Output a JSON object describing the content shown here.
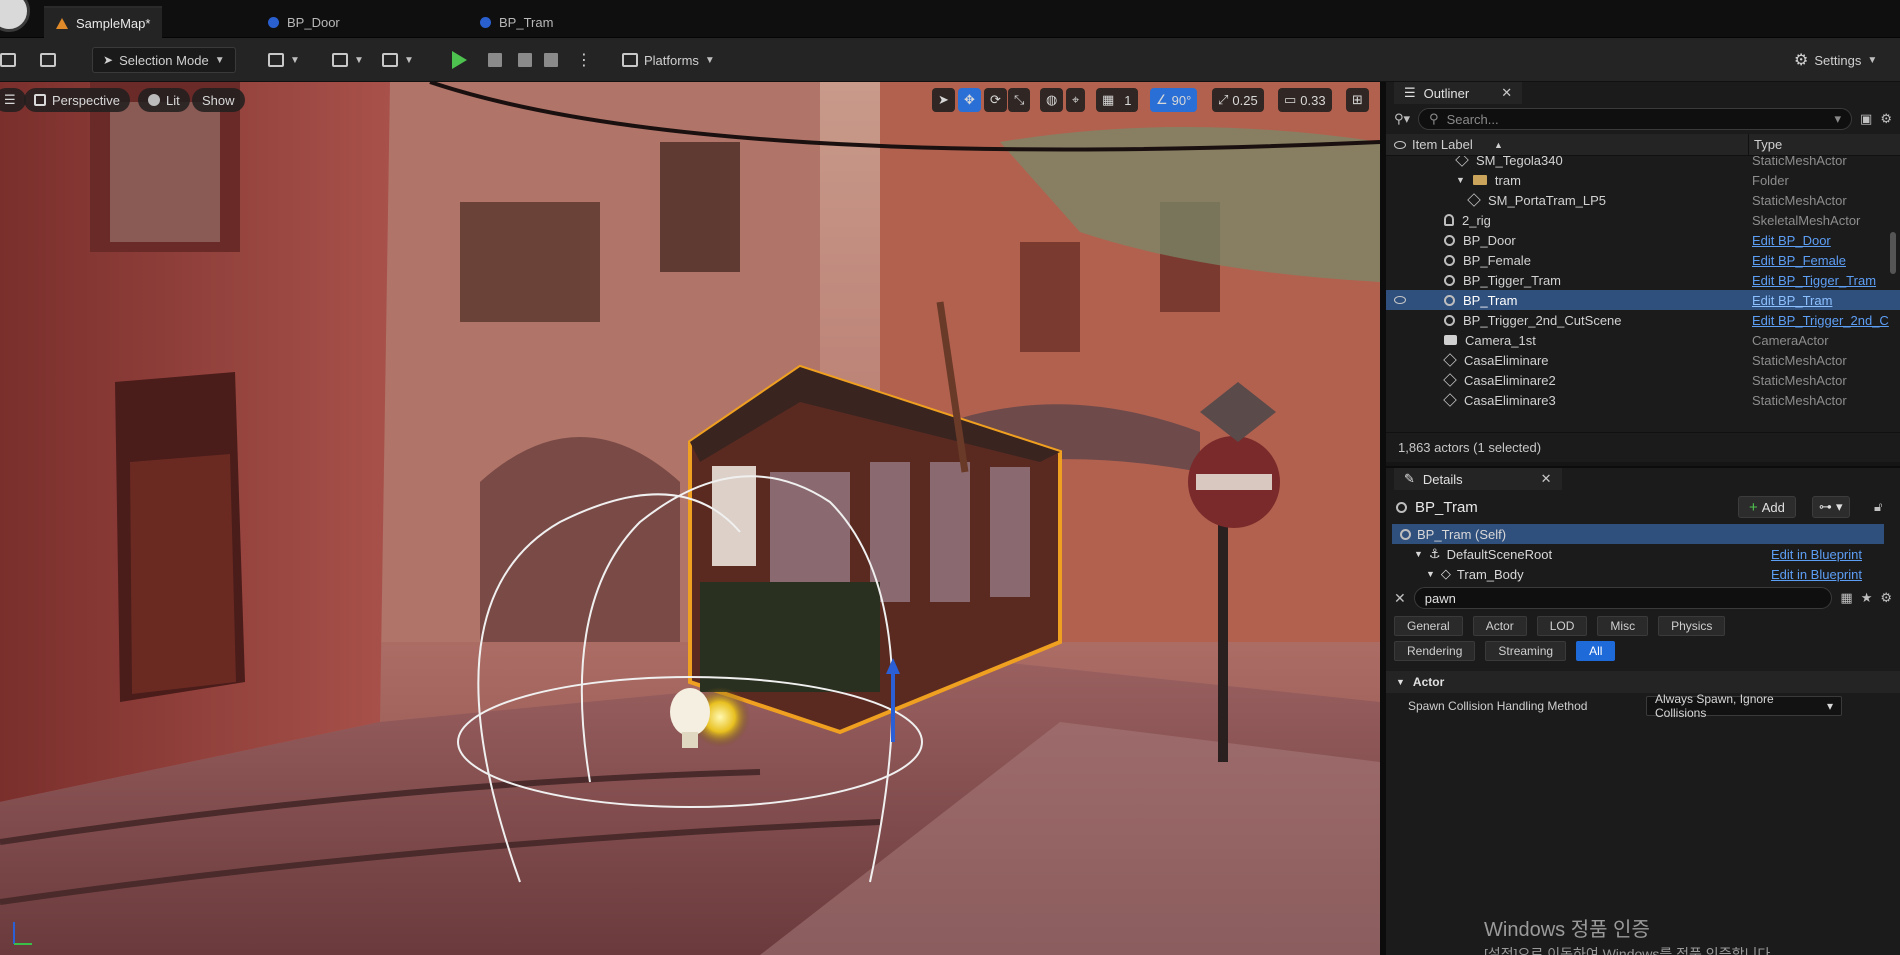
{
  "tabs": [
    {
      "label": "SampleMap*",
      "icon": "map-icon",
      "active": true
    },
    {
      "label": "BP_Door",
      "icon": "blueprint-icon",
      "active": false
    },
    {
      "label": "BP_Tram",
      "icon": "blueprint-icon",
      "active": false
    }
  ],
  "toolbar": {
    "selection_mode": "Selection Mode",
    "platforms": "Platforms",
    "settings": "Settings"
  },
  "viewport": {
    "perspective": "Perspective",
    "lit": "Lit",
    "show": "Show",
    "grid_snap": "1",
    "rotation_snap": "90°",
    "scale_snap": "0.25",
    "camera_speed": "0.33"
  },
  "outliner": {
    "title": "Outliner",
    "search_placeholder": "Search...",
    "col_label": "Item Label",
    "col_type": "Type",
    "items": [
      {
        "label": "SM_Tegola340",
        "type": "StaticMeshActor",
        "icon": "mesh-icon",
        "indent": 1,
        "link": false
      },
      {
        "label": "tram",
        "type": "Folder",
        "icon": "folder-icon",
        "indent": 1,
        "link": false
      },
      {
        "label": "SM_PortaTram_LP5",
        "type": "StaticMeshActor",
        "icon": "mesh-icon",
        "indent": 2,
        "link": false
      },
      {
        "label": "2_rig",
        "type": "SkeletalMeshActor",
        "icon": "skeletal-icon",
        "indent": 0,
        "link": false
      },
      {
        "label": "BP_Door",
        "type": "Edit BP_Door",
        "icon": "pawn-icon",
        "indent": 0,
        "link": true
      },
      {
        "label": "BP_Female",
        "type": "Edit BP_Female",
        "icon": "pawn-icon",
        "indent": 0,
        "link": true
      },
      {
        "label": "BP_Tigger_Tram",
        "type": "Edit BP_Tigger_Tram",
        "icon": "pawn-icon",
        "indent": 0,
        "link": true
      },
      {
        "label": "BP_Tram",
        "type": "Edit BP_Tram",
        "icon": "pawn-icon",
        "indent": 0,
        "link": true,
        "selected": true
      },
      {
        "label": "BP_Trigger_2nd_CutScene",
        "type": "Edit BP_Trigger_2nd_C",
        "icon": "pawn-icon",
        "indent": 0,
        "link": true
      },
      {
        "label": "Camera_1st",
        "type": "CameraActor",
        "icon": "camera-icon",
        "indent": 0,
        "link": false
      },
      {
        "label": "CasaEliminare",
        "type": "StaticMeshActor",
        "icon": "mesh-icon",
        "indent": 0,
        "link": false
      },
      {
        "label": "CasaEliminare2",
        "type": "StaticMeshActor",
        "icon": "mesh-icon",
        "indent": 0,
        "link": false
      },
      {
        "label": "CasaEliminare3",
        "type": "StaticMeshActor",
        "icon": "mesh-icon",
        "indent": 0,
        "link": false
      }
    ],
    "footer": "1,863 actors (1 selected)"
  },
  "details": {
    "title": "Details",
    "actor_name": "BP_Tram",
    "add_label": "Add",
    "components": [
      {
        "label": "BP_Tram (Self)",
        "link": ""
      },
      {
        "label": "DefaultSceneRoot",
        "link": "Edit in Blueprint"
      },
      {
        "label": "Tram_Body",
        "link": "Edit in Blueprint"
      }
    ],
    "search_value": "pawn",
    "filters": [
      "General",
      "Actor",
      "LOD",
      "Misc",
      "Physics",
      "Rendering",
      "Streaming",
      "All"
    ],
    "active_filter": "All",
    "category": "Actor",
    "property_label": "Spawn Collision Handling Method",
    "property_value": "Always Spawn, Ignore Collisions"
  },
  "watermark": {
    "line1": "Windows 정품 인증",
    "line2": "[설정]으로 이동하여 Windows를 정품 인증합니다."
  },
  "colors": {
    "accent": "#1f6ad9",
    "selection": "#2f4f7d",
    "link": "#5d9ef5",
    "play": "#4ec24e",
    "highlight_outline": "#f0a020"
  }
}
